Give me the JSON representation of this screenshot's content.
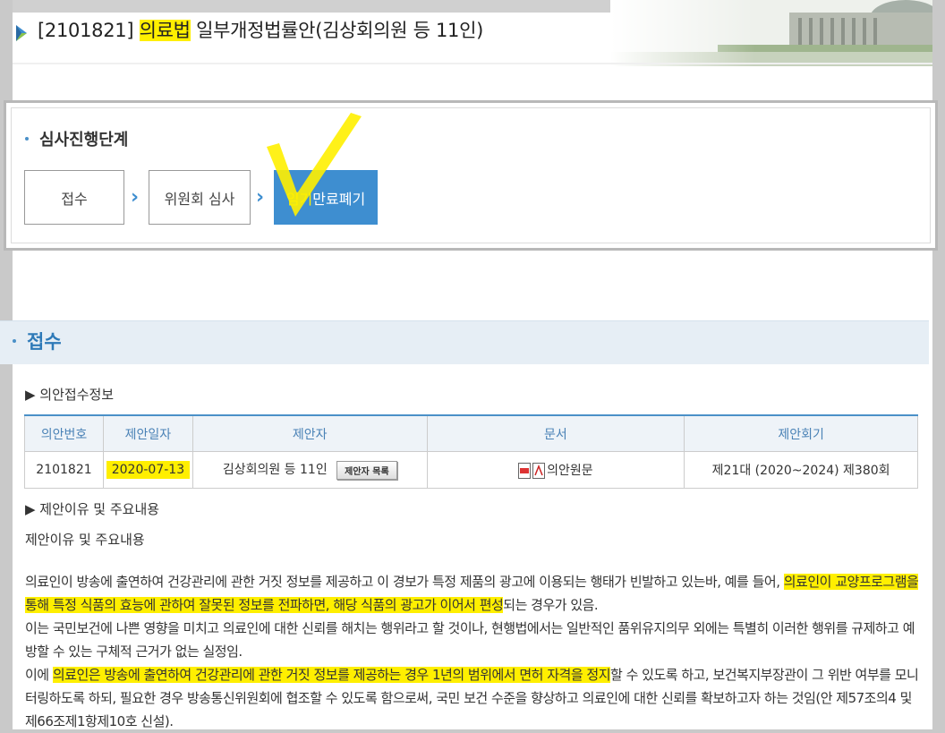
{
  "header": {
    "bill_no": "[2101821]",
    "bill_law": "의료법",
    "bill_rest": "일부개정법률안(김상회의원 등 11인)"
  },
  "stages": {
    "title": "심사진행단계",
    "steps": [
      "접수",
      "위원회 심사",
      "임기만료폐기"
    ],
    "active_hl": "임기",
    "active_rest": "만료폐기"
  },
  "section": {
    "title": "접수",
    "receipt_heading": "▶ 의안접수정보",
    "table": {
      "headers": [
        "의안번호",
        "제안일자",
        "제안자",
        "문서",
        "제안회기"
      ],
      "row": {
        "bill_no": "2101821",
        "date": "2020-07-13",
        "proposer": "김상회의원 등 11인",
        "proposer_button": "제안자 목록",
        "document": "의안원문",
        "session": "제21대 (2020~2024) 제380회"
      }
    },
    "reason_heading": "▶ 제안이유 및 주요내용",
    "reason_label": "제안이유 및 주요내용",
    "body": {
      "p1a": "의료인이 방송에 출연하여 건강관리에 관한 거짓 정보를 제공하고 이 경보가 특정 제품의 광고에 이용되는 행태가 빈발하고 있는바, 예를 들어, ",
      "p1b": "의료인이 교양프로그램을 통해 특정 식품의 효능에 관하여 잘못된 정보를 전파하면, 해당 식품의 광고가 이어서 편성",
      "p1c": "되는 경우가 있음.",
      "p2": "이는 국민보건에 나쁜 영향을 미치고 의료인에 대한 신뢰를 해치는 행위라고 할 것이나, 현행법에서는 일반적인 품위유지의무 외에는 특별히 이러한 행위를 규제하고 예방할 수 있는 구체적 근거가 없는 실정임.",
      "p3a": "이에 ",
      "p3b": "의료인은 방송에 출연하여 건강관리에 관한 거짓 정보를 제공하는 경우 1년의 범위에서 면허 자격을 정지",
      "p3c": "할 수 있도록 하고, 보건복지부장관이 그 위반 여부를 모니터링하도록 하되, 필요한 경우 방송통신위원회에 협조할 수 있도록 함으로써, 국민 보건 수준을 향상하고 의료인에 대한 신뢰를 확보하고자 하는 것임(안 제57조의4 및 제66조제1항제10호 신설)."
    }
  },
  "colors": {
    "accent": "#3e8ed0",
    "highlight": "#ffef00",
    "table_header_bg": "#eef3f8"
  }
}
